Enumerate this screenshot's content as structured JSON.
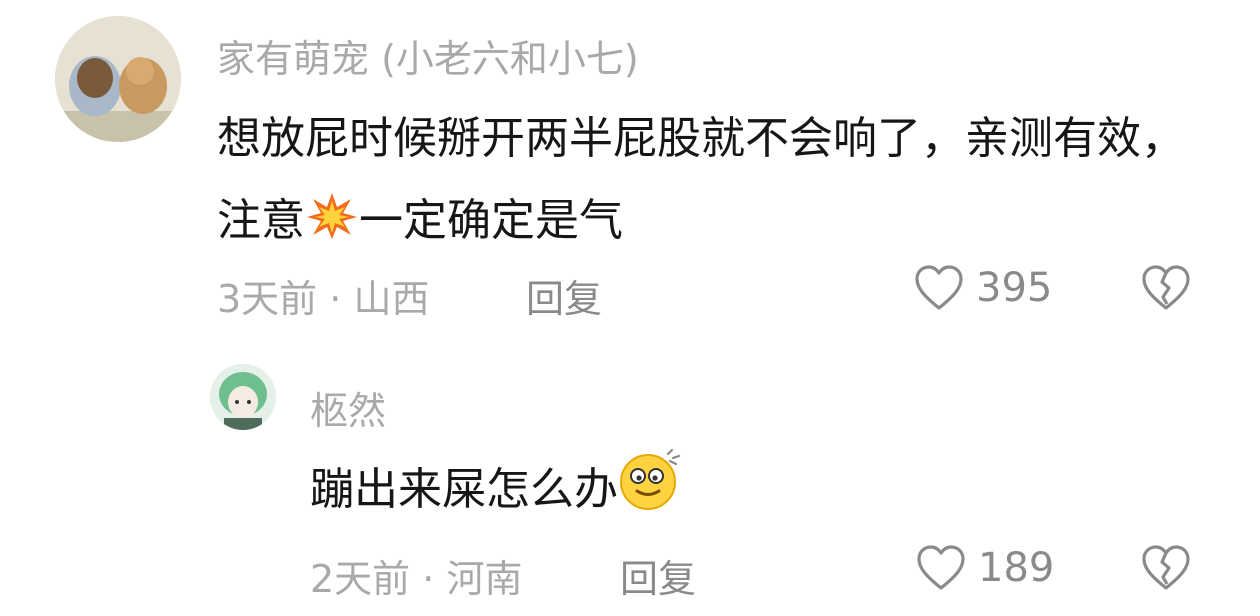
{
  "comments": [
    {
      "author": "家有萌宠 (小老六和小七)",
      "text_before_emoji": "想放屁时候掰开两半屁股就不会响了，亲测有效，注意",
      "emoji": "collision-emoji",
      "text_after_emoji": "一定确定是气",
      "time": "3天前",
      "location": "山西",
      "reply_label": "回复",
      "likes": "395"
    },
    {
      "author": "柩然",
      "text_before_emoji": "蹦出来屎怎么办",
      "emoji": "dizzy-face-emoji",
      "time": "2天前",
      "location": "河南",
      "reply_label": "回复",
      "likes": "189"
    }
  ],
  "colors": {
    "text": "#161616",
    "muted": "#a9a9a9",
    "icon": "#8a8a8a"
  },
  "icons": {
    "like": "heart-outline-icon",
    "dislike": "broken-heart-icon"
  }
}
